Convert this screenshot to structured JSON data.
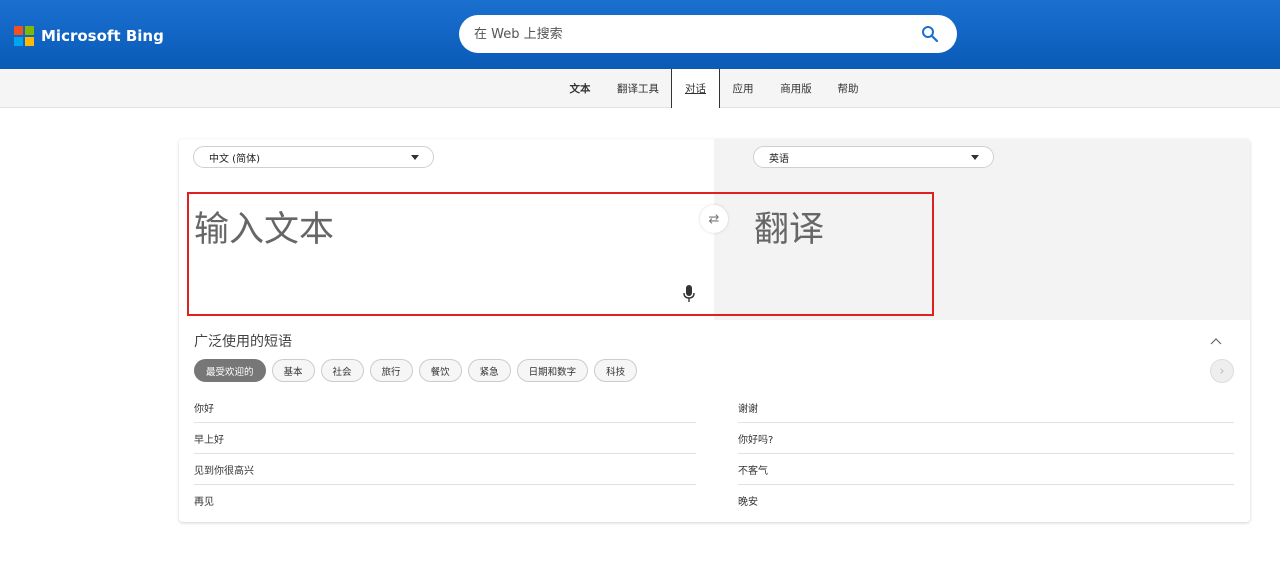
{
  "header": {
    "brand": "Microsoft Bing",
    "logo_colors": [
      "#f25022",
      "#7fba00",
      "#00a4ef",
      "#ffb900"
    ],
    "search": {
      "placeholder": "在 Web 上搜索",
      "value": ""
    },
    "search_icon": "search-icon"
  },
  "nav": {
    "items": [
      {
        "label": "文本"
      },
      {
        "label": "翻译工具"
      },
      {
        "label": "对话"
      },
      {
        "label": "应用"
      },
      {
        "label": "商用版"
      },
      {
        "label": "帮助"
      }
    ],
    "active": "对话"
  },
  "translator": {
    "source_language": "中文 (简体)",
    "target_language": "英语",
    "source_placeholder": "输入文本",
    "target_placeholder": "翻译",
    "swap_icon": "swap-icon",
    "mic_icon": "microphone-icon",
    "highlight_color": "#e02020"
  },
  "phrases": {
    "title": "广泛使用的短语",
    "categories": [
      "最受欢迎的",
      "基本",
      "社会",
      "旅行",
      "餐饮",
      "紧急",
      "日期和数字",
      "科技"
    ],
    "active_category": "最受欢迎的",
    "left": [
      "你好",
      "早上好",
      "见到你很高兴",
      "再见"
    ],
    "right": [
      "谢谢",
      "你好吗?",
      "不客气",
      "晚安"
    ]
  }
}
